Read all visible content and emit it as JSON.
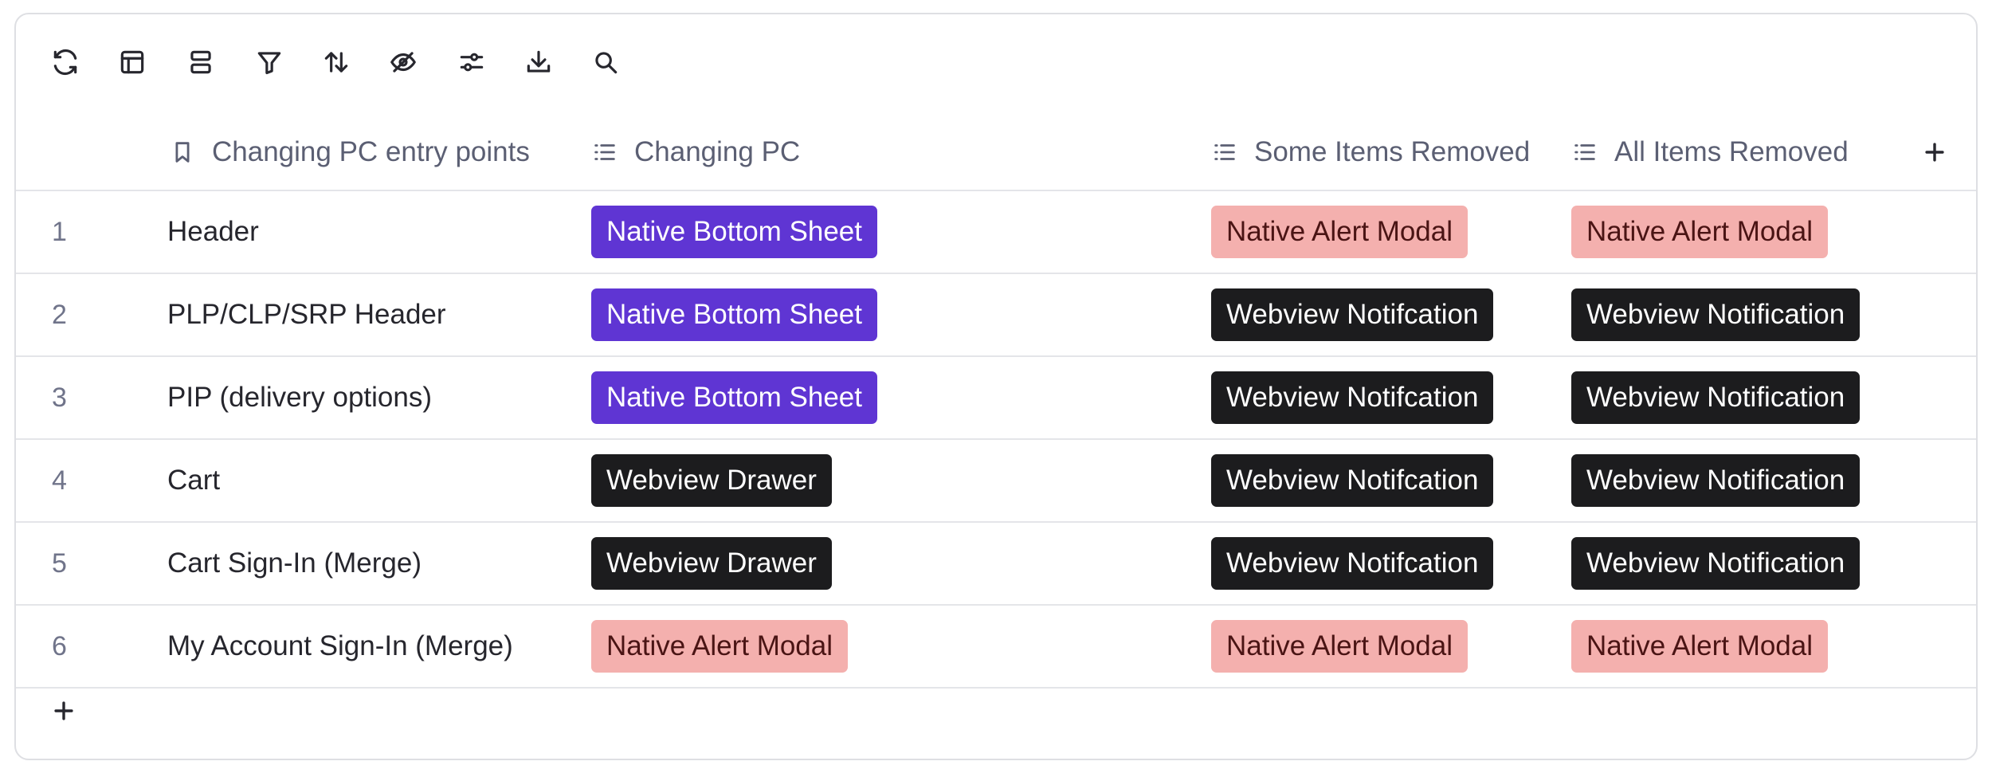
{
  "toolbar": {
    "icons": [
      "refresh-icon",
      "layout-icon",
      "group-icon",
      "filter-icon",
      "sort-icon",
      "hide-icon",
      "settings-sliders-icon",
      "download-icon",
      "search-icon"
    ]
  },
  "columns": [
    {
      "label": "Changing PC entry points",
      "icon": "bookmark-icon"
    },
    {
      "label": "Changing PC",
      "icon": "list-icon"
    },
    {
      "label": "Some Items Removed",
      "icon": "list-icon"
    },
    {
      "label": "All Items Removed",
      "icon": "list-icon"
    }
  ],
  "rows": [
    {
      "num": "1",
      "entry": "Header",
      "changing_pc": "Native Bottom Sheet",
      "some_removed": "Native Alert Modal",
      "all_removed": "Native Alert Modal"
    },
    {
      "num": "2",
      "entry": "PLP/CLP/SRP Header",
      "changing_pc": "Native Bottom Sheet",
      "some_removed": "Webview Notifcation",
      "all_removed": "Webview Notification"
    },
    {
      "num": "3",
      "entry": "PIP (delivery options)",
      "changing_pc": "Native Bottom Sheet",
      "some_removed": "Webview Notifcation",
      "all_removed": "Webview Notification"
    },
    {
      "num": "4",
      "entry": "Cart",
      "changing_pc": "Webview Drawer",
      "some_removed": "Webview Notifcation",
      "all_removed": "Webview Notification"
    },
    {
      "num": "5",
      "entry": "Cart Sign-In (Merge)",
      "changing_pc": "Webview Drawer",
      "some_removed": "Webview Notifcation",
      "all_removed": "Webview Notification"
    },
    {
      "num": "6",
      "entry": "My Account Sign-In (Merge)",
      "changing_pc": "Native Alert Modal",
      "some_removed": "Native Alert Modal",
      "all_removed": "Native Alert Modal"
    }
  ],
  "tag_colors": {
    "Native Bottom Sheet": "#5f35d3",
    "Native Alert Modal": "#f4b0ae",
    "Webview Notifcation": "#1c1c1e",
    "Webview Notification": "#1c1c1e",
    "Webview Drawer": "#1c1c1e"
  }
}
